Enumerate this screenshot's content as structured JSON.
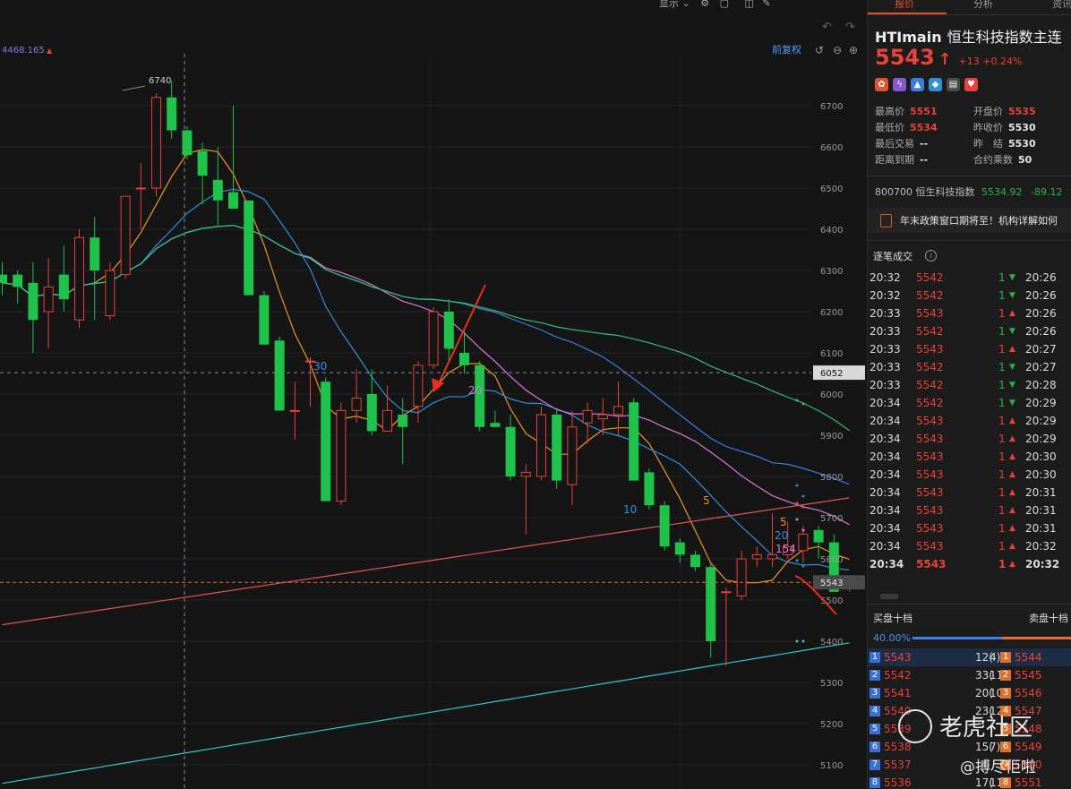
{
  "toolbar": {
    "display_label": "显示",
    "adjust_label": "前复权"
  },
  "chart": {
    "top_left_value": "4468.165",
    "high_annotation": "6740",
    "price_tag_last": "5543",
    "price_tag_cross": "6052",
    "ma_labels": [
      "30",
      "20",
      "10",
      "5",
      "5",
      "20",
      "154"
    ]
  },
  "quote": {
    "tabs": [
      "报价",
      "分析",
      "资讯"
    ],
    "symbol": "HTImain",
    "name": "恒生科技指数主连",
    "last_price": "5543",
    "change": "+13 +0.24%",
    "stats": [
      {
        "label": "最高价",
        "value": "5551",
        "color": "red"
      },
      {
        "label": "开盘价",
        "value": "5535",
        "color": "red"
      },
      {
        "label": "最低价",
        "value": "5534",
        "color": "red"
      },
      {
        "label": "昨收价",
        "value": "5530",
        "color": "white"
      },
      {
        "label": "最后交易",
        "value": "--",
        "color": "white"
      },
      {
        "label": "昨　结",
        "value": "5530",
        "color": "white"
      },
      {
        "label": "距离到期",
        "value": "--",
        "color": "white"
      },
      {
        "label": "合约乘数",
        "value": "50",
        "color": "white"
      }
    ],
    "index_code": "800700",
    "index_name": "恒生科技指数",
    "index_value": "5534.92",
    "index_change": "-89.12",
    "news": "年末政策窗口期将至！机构详解如何"
  },
  "ticks": {
    "title": "逐笔成交",
    "rows": [
      {
        "time": "20:32",
        "price": "5542",
        "qty": "1",
        "dir": "down",
        "ts": "20:26"
      },
      {
        "time": "20:32",
        "price": "5542",
        "qty": "1",
        "dir": "down",
        "ts": "20:26"
      },
      {
        "time": "20:33",
        "price": "5543",
        "qty": "1",
        "dir": "up",
        "ts": "20:26"
      },
      {
        "time": "20:33",
        "price": "5542",
        "qty": "1",
        "dir": "down",
        "ts": "20:26"
      },
      {
        "time": "20:33",
        "price": "5543",
        "qty": "1",
        "dir": "up",
        "ts": "20:27"
      },
      {
        "time": "20:33",
        "price": "5542",
        "qty": "1",
        "dir": "down",
        "ts": "20:27"
      },
      {
        "time": "20:33",
        "price": "5542",
        "qty": "1",
        "dir": "down",
        "ts": "20:28"
      },
      {
        "time": "20:34",
        "price": "5542",
        "qty": "1",
        "dir": "down",
        "ts": "20:29"
      },
      {
        "time": "20:34",
        "price": "5543",
        "qty": "1",
        "dir": "up",
        "ts": "20:29"
      },
      {
        "time": "20:34",
        "price": "5543",
        "qty": "1",
        "dir": "up",
        "ts": "20:29"
      },
      {
        "time": "20:34",
        "price": "5543",
        "qty": "1",
        "dir": "up",
        "ts": "20:30"
      },
      {
        "time": "20:34",
        "price": "5543",
        "qty": "1",
        "dir": "up",
        "ts": "20:30"
      },
      {
        "time": "20:34",
        "price": "5543",
        "qty": "1",
        "dir": "up",
        "ts": "20:31"
      },
      {
        "time": "20:34",
        "price": "5543",
        "qty": "1",
        "dir": "up",
        "ts": "20:31"
      },
      {
        "time": "20:34",
        "price": "5543",
        "qty": "1",
        "dir": "up",
        "ts": "20:31"
      },
      {
        "time": "20:34",
        "price": "5543",
        "qty": "1",
        "dir": "up",
        "ts": "20:32"
      },
      {
        "time": "20:34",
        "price": "5543",
        "qty": "1",
        "dir": "up",
        "ts": "20:32"
      }
    ]
  },
  "orderbook": {
    "bid_title": "买盘十档",
    "ask_title": "卖盘十档",
    "bid_ratio": "40.00%",
    "rows": [
      {
        "lvl": "1",
        "bid": "5543",
        "bq": "12(",
        "bo": "4)",
        "slvl": "1",
        "ask": "5544"
      },
      {
        "lvl": "2",
        "bid": "5542",
        "bq": "33(",
        "bo": "11)",
        "slvl": "2",
        "ask": "5545"
      },
      {
        "lvl": "3",
        "bid": "5541",
        "bq": "20(",
        "bo": "10)",
        "slvl": "3",
        "ask": "5546"
      },
      {
        "lvl": "4",
        "bid": "5540",
        "bq": "23(",
        "bo": "12)",
        "slvl": "4",
        "ask": "5547"
      },
      {
        "lvl": "5",
        "bid": "5539",
        "bq": "",
        "bo": "",
        "slvl": "5",
        "ask": "5548"
      },
      {
        "lvl": "6",
        "bid": "5538",
        "bq": "15(",
        "bo": "7)",
        "slvl": "6",
        "ask": "5549"
      },
      {
        "lvl": "7",
        "bid": "5537",
        "bq": "",
        "bo": "",
        "slvl": "7",
        "ask": "5550"
      },
      {
        "lvl": "8",
        "bid": "5536",
        "bq": "17(",
        "bo": "11)",
        "slvl": "8",
        "ask": "5551"
      }
    ]
  },
  "watermark": {
    "brand": "老虎社区",
    "author": "@搏尽佢啦"
  },
  "chart_data": {
    "type": "candlestick",
    "y_ticks": [
      6700,
      6600,
      6500,
      6400,
      6300,
      6200,
      6100,
      6000,
      5900,
      5800,
      5700,
      5600,
      5500,
      5400,
      5300,
      5200,
      5100
    ],
    "ylim": [
      5040,
      6810
    ],
    "candles": [
      [
        6290,
        6320,
        6240,
        6270
      ],
      [
        6290,
        6300,
        6220,
        6260
      ],
      [
        6270,
        6320,
        6100,
        6180
      ],
      [
        6200,
        6330,
        6110,
        6260
      ],
      [
        6290,
        6360,
        6200,
        6230
      ],
      [
        6180,
        6400,
        6160,
        6380
      ],
      [
        6380,
        6430,
        6180,
        6300
      ],
      [
        6190,
        6320,
        6180,
        6300
      ],
      [
        6290,
        6430,
        6280,
        6480
      ],
      [
        6500,
        6560,
        6400,
        6500
      ],
      [
        6500,
        6730,
        6480,
        6720
      ],
      [
        6720,
        6760,
        6620,
        6640
      ],
      [
        6640,
        6650,
        6570,
        6580
      ],
      [
        6590,
        6610,
        6460,
        6530
      ],
      [
        6520,
        6600,
        6410,
        6470
      ],
      [
        6490,
        6700,
        6460,
        6450
      ],
      [
        6470,
        6470,
        6240,
        6240
      ],
      [
        6240,
        6250,
        6120,
        6120
      ],
      [
        6130,
        6140,
        5960,
        5960
      ],
      [
        5960,
        6030,
        5890,
        5960
      ],
      [
        6080,
        6090,
        5970,
        6080
      ],
      [
        6030,
        6040,
        5740,
        5740
      ],
      [
        5740,
        5980,
        5730,
        5960
      ],
      [
        5960,
        6060,
        5930,
        5990
      ],
      [
        6000,
        6060,
        5900,
        5910
      ],
      [
        5910,
        6020,
        5920,
        5960
      ],
      [
        5950,
        5990,
        5830,
        5920
      ],
      [
        5970,
        6080,
        5930,
        6070
      ],
      [
        6070,
        6210,
        6060,
        6200
      ],
      [
        6200,
        6230,
        6080,
        6110
      ],
      [
        6100,
        6160,
        6050,
        6070
      ],
      [
        6070,
        6080,
        5910,
        5920
      ],
      [
        5930,
        5960,
        5920,
        5920
      ],
      [
        5920,
        5950,
        5790,
        5800
      ],
      [
        5800,
        5830,
        5660,
        5810
      ],
      [
        5800,
        5970,
        5790,
        5950
      ],
      [
        5950,
        5960,
        5770,
        5790
      ],
      [
        5780,
        5960,
        5730,
        5920
      ],
      [
        5930,
        5980,
        5880,
        5960
      ],
      [
        5940,
        5990,
        5900,
        5950
      ],
      [
        5950,
        6030,
        5900,
        5970
      ],
      [
        5980,
        5990,
        5790,
        5790
      ],
      [
        5810,
        5820,
        5720,
        5730
      ],
      [
        5730,
        5740,
        5620,
        5630
      ],
      [
        5640,
        5650,
        5590,
        5610
      ],
      [
        5610,
        5620,
        5570,
        5580
      ],
      [
        5580,
        5590,
        5360,
        5400
      ],
      [
        5520,
        5530,
        5340,
        5520
      ],
      [
        5510,
        5620,
        5500,
        5600
      ],
      [
        5600,
        5630,
        5580,
        5610
      ],
      [
        5600,
        5710,
        5580,
        5610
      ],
      [
        5610,
        5690,
        5600,
        5630
      ],
      [
        5620,
        5680,
        5590,
        5660
      ],
      [
        5670,
        5680,
        5600,
        5640
      ],
      [
        5640,
        5660,
        5520,
        5520
      ],
      [
        5530,
        5551,
        5520,
        5543
      ]
    ]
  }
}
